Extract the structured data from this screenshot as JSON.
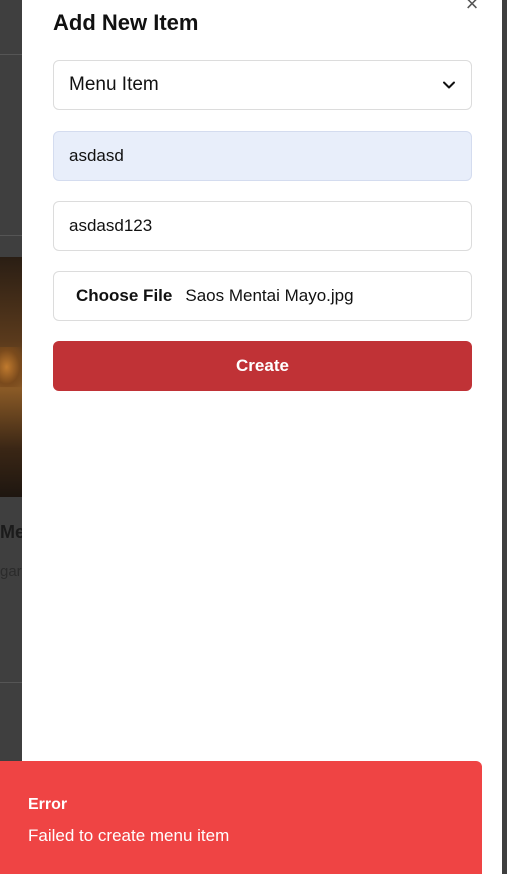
{
  "modal": {
    "title": "Add New Item",
    "close_label": "×",
    "type_select": {
      "selected": "Menu Item"
    },
    "name_field": {
      "value": "asdasd"
    },
    "second_field": {
      "value": "asdasd123"
    },
    "file_input": {
      "button_label": "Choose File",
      "file_name": "Saos Mentai Mayo.jpg"
    },
    "submit_label": "Create"
  },
  "background": {
    "card_title_fragment": "Me",
    "card_sub_fragment": "gar"
  },
  "toast": {
    "title": "Error",
    "message": "Failed to create menu item",
    "color": "#ef4444"
  },
  "colors": {
    "primary_button": "#c03236",
    "autofill_bg": "#e8eefa"
  }
}
